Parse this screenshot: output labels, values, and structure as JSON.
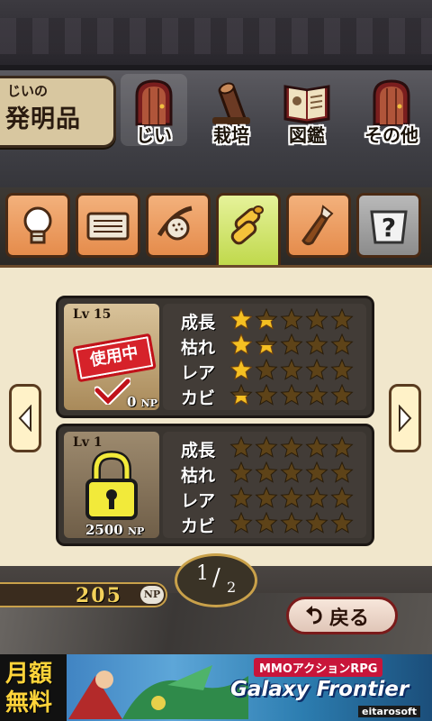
{
  "header": {
    "title_small": "じいの",
    "title_big": "発明品",
    "nav": [
      {
        "label": "じい",
        "icon": "door-icon",
        "selected": true
      },
      {
        "label": "栽培",
        "icon": "log-icon",
        "selected": false
      },
      {
        "label": "図鑑",
        "icon": "book-icon",
        "selected": false
      },
      {
        "label": "その他",
        "icon": "door-icon",
        "selected": false
      }
    ]
  },
  "categories": [
    {
      "icon": "lightbulb-icon",
      "selected": false
    },
    {
      "icon": "heater-icon",
      "selected": false
    },
    {
      "icon": "shower-icon",
      "selected": false
    },
    {
      "icon": "firewood-icon",
      "selected": true
    },
    {
      "icon": "bottle-icon",
      "selected": false
    },
    {
      "icon": "question-icon",
      "selected": false
    }
  ],
  "items": [
    {
      "level_label": "Lv 15",
      "status_stamp": "使用中",
      "cost": "0",
      "cost_unit": "NP",
      "locked": false,
      "stats": [
        {
          "label": "成長",
          "rating": 1.5
        },
        {
          "label": "枯れ",
          "rating": 1.5
        },
        {
          "label": "レア",
          "rating": 1.0
        },
        {
          "label": "カビ",
          "rating": 0.5
        }
      ]
    },
    {
      "level_label": "Lv  1",
      "cost": "2500",
      "cost_unit": "NP",
      "locked": true,
      "stats": [
        {
          "label": "成長",
          "rating": 0
        },
        {
          "label": "枯れ",
          "rating": 0
        },
        {
          "label": "レア",
          "rating": 0
        },
        {
          "label": "カビ",
          "rating": 0
        }
      ]
    }
  ],
  "footer": {
    "np_value": "205",
    "np_unit": "NP",
    "page_current": "1",
    "page_slash": "/",
    "page_total": "2",
    "back_label": "戻る"
  },
  "ad": {
    "left_text": "月額無料",
    "subtitle": "MMOアクションRPG",
    "title": "Galaxy Frontier",
    "brand": "eitarosoft"
  },
  "colors": {
    "parchment": "#f1e7cc",
    "tab_orange": "#e58c4c",
    "tab_selected": "#bfd84a",
    "star_gold": "#f5c022",
    "star_empty": "#5e4318",
    "stamp_red": "#d6222a"
  }
}
